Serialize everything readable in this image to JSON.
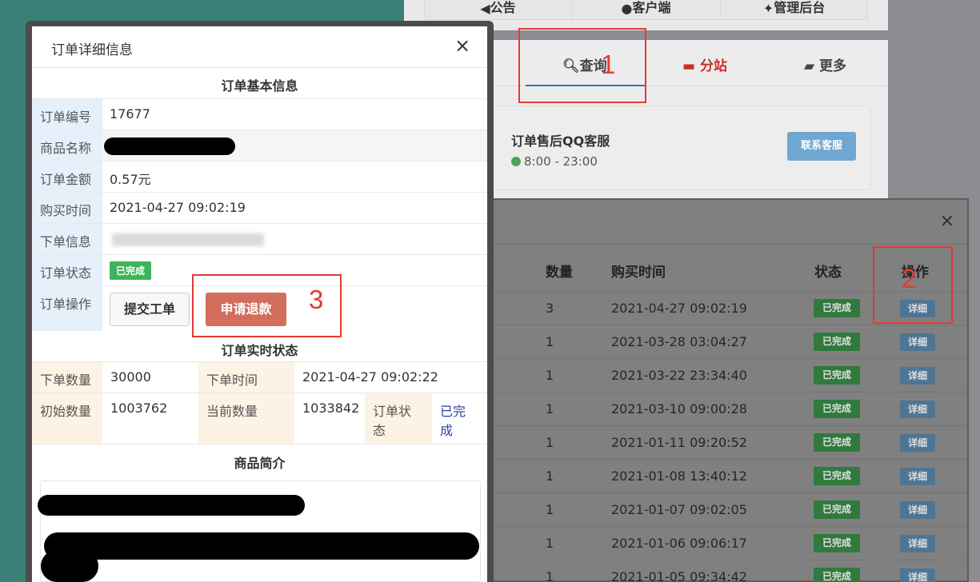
{
  "top_nav": {
    "items": [
      "公告",
      "客户端",
      "管理后台"
    ]
  },
  "tabs": [
    {
      "label": "查询"
    },
    {
      "label": "分站"
    },
    {
      "label": "更多"
    }
  ],
  "service": {
    "title": "订单售后QQ客服",
    "hours": "8:00 - 23:00",
    "button": "联系客服"
  },
  "order_list": {
    "close": "×",
    "headers": {
      "qty": "数量",
      "time": "购买时间",
      "status": "状态",
      "op": "操作"
    },
    "rows": [
      {
        "qty": "3",
        "time": "2021-04-27 09:02:19",
        "status": "已完成",
        "op": "详细"
      },
      {
        "qty": "1",
        "time": "2021-03-28 03:04:27",
        "status": "已完成",
        "op": "详细"
      },
      {
        "qty": "1",
        "time": "2021-03-22 23:34:40",
        "status": "已完成",
        "op": "详细"
      },
      {
        "qty": "1",
        "time": "2021-03-10 09:00:28",
        "status": "已完成",
        "op": "详细"
      },
      {
        "qty": "1",
        "time": "2021-01-11 09:20:52",
        "status": "已完成",
        "op": "详细"
      },
      {
        "qty": "1",
        "time": "2021-01-08 13:40:12",
        "status": "已完成",
        "op": "详细"
      },
      {
        "qty": "1",
        "time": "2021-01-07 09:02:05",
        "status": "已完成",
        "op": "详细"
      },
      {
        "qty": "1",
        "time": "2021-01-06 09:06:17",
        "status": "已完成",
        "op": "详细"
      },
      {
        "qty": "1",
        "time": "2021-01-05 09:34:42",
        "status": "已完成",
        "op": "详细"
      }
    ]
  },
  "detail": {
    "title": "订单详细信息",
    "close": "×",
    "basic_title": "订单基本信息",
    "order_no_label": "订单编号",
    "order_no": "17677",
    "product_label": "商品名称",
    "amount_label": "订单金额",
    "amount": "0.57元",
    "buy_time_label": "购买时间",
    "buy_time": "2021-04-27 09:02:19",
    "order_info_label": "下单信息",
    "status_label": "订单状态",
    "status": "已完成",
    "ops_label": "订单操作",
    "ticket_btn": "提交工单",
    "refund_btn": "申请退款",
    "realtime_title": "订单实时状态",
    "qty_label": "下单数量",
    "qty": "30000",
    "order_time_label": "下单时间",
    "order_time": "2021-04-27 09:02:22",
    "init_label": "初始数量",
    "init": "1003762",
    "current_label": "当前数量",
    "current": "1033842",
    "rt_status_label": "订单状态",
    "rt_status": "已完成",
    "intro_title": "商品简介"
  },
  "annotations": [
    "1",
    "2",
    "3"
  ],
  "colors": {
    "accent": "#3a6fb5",
    "success": "#3db35b",
    "danger": "#d36d5c",
    "annotation": "#e23b32"
  }
}
